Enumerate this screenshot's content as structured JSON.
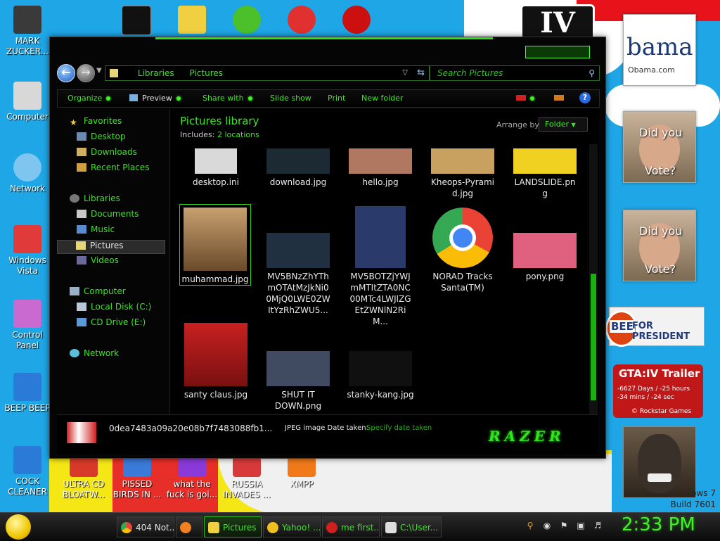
{
  "desktop": {
    "gta_logo": "IV",
    "obama_big": "bama",
    "obama_small": "Obama.com",
    "vote1_line1": "Did you",
    "vote1_line2": "Vote?",
    "vote2_line1": "Did you",
    "vote2_line2": "Vote?",
    "bee_badge": "BEE",
    "bee_text": "FOR PRESIDENT",
    "gta_trailer_title": "GTA:IV Trailer",
    "gta_trailer_line1": "-6627 Days / -25 hours",
    "gta_trailer_line2": "-34 mins / -24 sec",
    "gta_trailer_line3": "© Rockstar Games",
    "build_line1": "ows 7",
    "build_line2": "Build 7601",
    "icons_left": [
      {
        "label": "MARK ZUCKER...",
        "color": "#3a3a3a"
      },
      {
        "label": "Computer",
        "color": "#d8d8d8"
      },
      {
        "label": "Network",
        "color": "#7ec6f0"
      },
      {
        "label": "Windows Vista",
        "color": "#e03a3a"
      },
      {
        "label": "Control Panel",
        "color": "#c86ad0"
      },
      {
        "label": "BEEP BEEP",
        "color": "#2a7ad8"
      },
      {
        "label": "COCK CLEANER",
        "color": "#2a7ad8"
      }
    ],
    "icons_top": [
      {
        "label": "",
        "color": "#111111"
      },
      {
        "label": "",
        "color": "#f0d040"
      },
      {
        "label": "",
        "color": "#4cc02a"
      },
      {
        "label": "",
        "color": "#e03030"
      },
      {
        "label": "",
        "color": "#cc1010"
      }
    ],
    "icons_bottom": [
      {
        "label": "ULTRA CD BLOATW...",
        "color": "#d83a2a"
      },
      {
        "label": "PISSED BIRDS IN ...",
        "color": "#3a7ad8"
      },
      {
        "label": "what the fuck is goi...",
        "color": "#8a3ad8"
      },
      {
        "label": "RUSSIA INVADES ...",
        "color": "#d83a3a"
      },
      {
        "label": "XMPP",
        "color": "#f07a1a"
      }
    ]
  },
  "window": {
    "address": {
      "crumb1": "Libraries",
      "crumb2": "Pictures"
    },
    "search_placeholder": "Search Pictures",
    "toolbar": {
      "organize": "Organize",
      "preview": "Preview",
      "share_with": "Share with",
      "slide_show": "Slide show",
      "print": "Print",
      "new_folder": "New folder"
    },
    "sidebar": {
      "favorites": "Favorites",
      "desktop": "Desktop",
      "downloads": "Downloads",
      "recent_places": "Recent Places",
      "libraries": "Libraries",
      "documents": "Documents",
      "music": "Music",
      "pictures": "Pictures",
      "videos": "Videos",
      "computer": "Computer",
      "local_disk": "Local Disk (C:)",
      "cd_drive": "CD Drive (E:)",
      "network": "Network"
    },
    "library": {
      "title": "Pictures library",
      "includes_label": "Includes:",
      "includes_link": "2 locations",
      "arrange_label": "Arrange by:",
      "arrange_value": "Folder"
    },
    "files": [
      {
        "name": "desktop.ini",
        "color": "#d9d9d9"
      },
      {
        "name": "download.jpg",
        "color": "#1c2a33"
      },
      {
        "name": "hello.jpg",
        "color": "#b07860"
      },
      {
        "name": "Kheops-Pyramid.jpg",
        "color": "#c8a060"
      },
      {
        "name": "LANDSLIDE.png",
        "color": "#f0d020"
      },
      {
        "name": "muhammad.jpg",
        "color": "#8a6a40"
      },
      {
        "name": "MV5BNzZhYThmOTAtMzJkNi00MjQ0LWE0ZWItYzRhZWU5...",
        "color": "#203040"
      },
      {
        "name": "MV5BOTZjYWJmMTItZTA0NC00MTc4LWJlZGEtZWNlN2RiM...",
        "color": "#2a3a6a"
      },
      {
        "name": "NORAD Tracks Santa(TM)",
        "color": "#ffffff"
      },
      {
        "name": "pony.png",
        "color": "#e06080"
      },
      {
        "name": "santy claus.jpg",
        "color": "#c82020"
      },
      {
        "name": "SHUT IT DOWN.png",
        "color": "#404a60"
      },
      {
        "name": "stanky-kang.jpg",
        "color": "#101010"
      }
    ],
    "details": {
      "filename": "0dea7483a09a20e08b7f7483088fb1...",
      "kind": "JPEG image Date taken:",
      "date_taken": "Specify date taken",
      "brand": "RAZER"
    }
  },
  "taskbar": {
    "tasks": [
      {
        "label": "404 Not...",
        "color": "#e04030"
      },
      {
        "label": "",
        "color": "#f08020"
      },
      {
        "label": "Pictures",
        "color": "#f0d040"
      },
      {
        "label": "Yahoo! ...",
        "color": "#f0c020"
      },
      {
        "label": "me first...",
        "color": "#d02020"
      },
      {
        "label": "C:\\User...",
        "color": "#dddddd"
      }
    ],
    "clock": "2:33 PM"
  }
}
